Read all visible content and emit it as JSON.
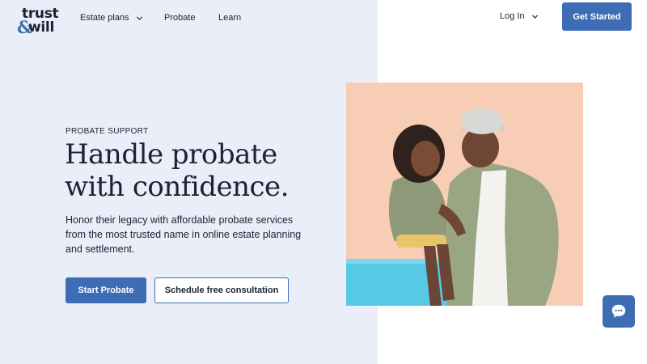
{
  "brand": {
    "logo_line1": "trust",
    "logo_amp": "&",
    "logo_line2": "will",
    "accent_color": "#3f6db5",
    "panel_color": "#e9eef8"
  },
  "header": {
    "nav": {
      "estate_plans": "Estate plans",
      "probate": "Probate",
      "learn": "Learn",
      "login": "Log In"
    },
    "cta_label": "Get Started",
    "dropdown_icon": "chevron-down-icon"
  },
  "hero": {
    "eyebrow": "PROBATE SUPPORT",
    "headline": "Handle probate with confidence.",
    "subtext": "Honor their legacy with affordable probate services from the most trusted name in online estate planning and settlement.",
    "primary_button": "Start Probate",
    "secondary_button": "Schedule free consultation",
    "image": "photo-grandmother-and-granddaughter"
  },
  "chat": {
    "icon": "chat-bubble-icon"
  }
}
